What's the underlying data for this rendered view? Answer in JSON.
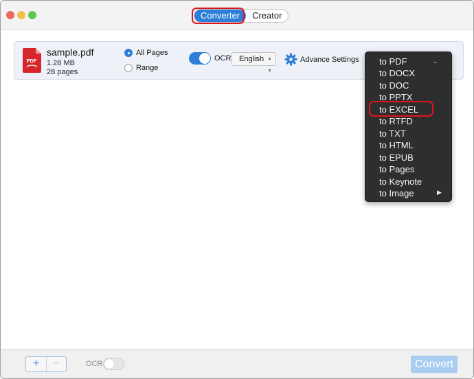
{
  "window": {
    "tabs": [
      {
        "label": "Converter",
        "active": true
      },
      {
        "label": "Creator",
        "active": false
      }
    ]
  },
  "file": {
    "name": "sample.pdf",
    "size": "1.28 MB",
    "pages": "28 pages",
    "icon": "pdf-file-icon",
    "icon_text": "PDF"
  },
  "options": {
    "page_range": {
      "all_pages_label": "All Pages",
      "range_label": "Range",
      "selected": "All Pages"
    },
    "ocr_label": "OCR",
    "ocr_enabled": true,
    "language": "English",
    "advance_settings_label": "Advance Settings"
  },
  "format_menu": {
    "items": [
      "to PDF",
      "to DOCX",
      "to DOC",
      "to PPTX",
      "to EXCEL",
      "to RTFD",
      "to TXT",
      "to HTML",
      "to EPUB",
      "to Pages",
      "to Keynote",
      "to Image"
    ],
    "highlighted": "to EXCEL"
  },
  "bottom": {
    "add_label": "+",
    "remove_label": "−",
    "ocr_label": "OCR",
    "ocr_enabled": false,
    "convert_label": "Convert"
  },
  "colors": {
    "accent": "#2c7ed9",
    "highlight": "#e0141e",
    "pdf_red": "#d7262b",
    "menu_bg": "#2e2e2e",
    "convert_disabled": "#a8cdf1"
  }
}
